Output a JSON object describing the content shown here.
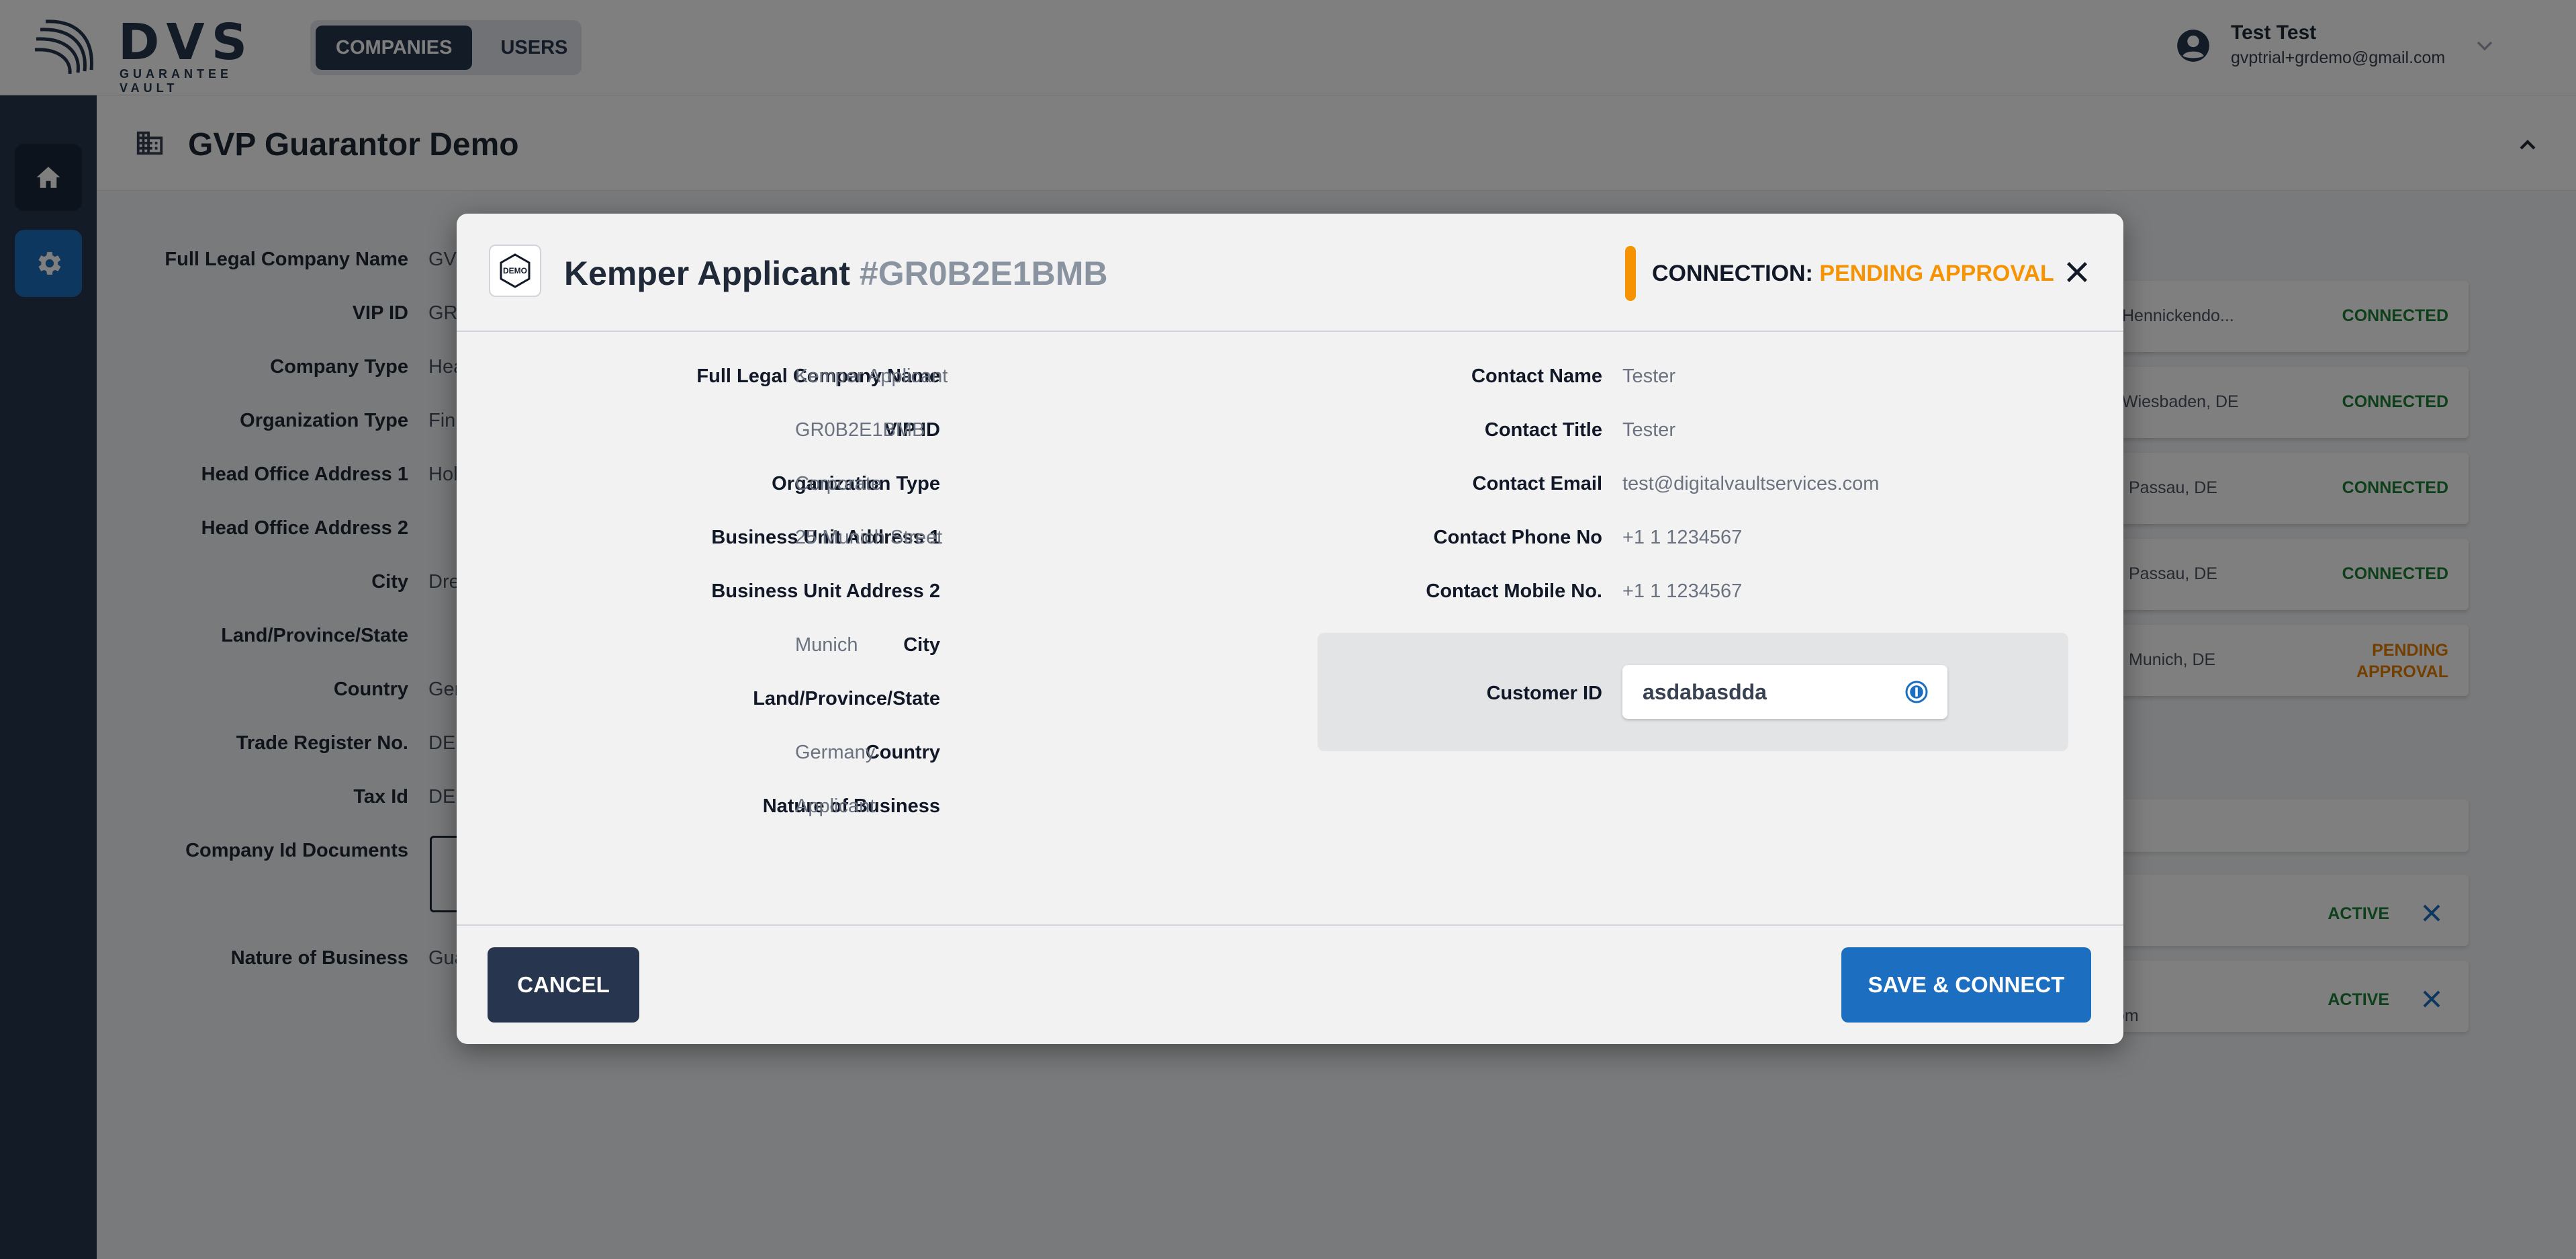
{
  "brand": {
    "name": "DVS",
    "tagline": "GUARANTEE VAULT"
  },
  "topnav": {
    "items": [
      {
        "label": "COMPANIES"
      },
      {
        "label": "USERS"
      }
    ]
  },
  "user": {
    "name": "Test Test",
    "email": "gvptrial+grdemo@gmail.com"
  },
  "sidebar": {
    "items": [
      {
        "icon": "home-icon"
      },
      {
        "icon": "gear-icon"
      }
    ]
  },
  "page": {
    "title": "GVP Guarantor Demo"
  },
  "background_fields": [
    {
      "label": "Full Legal Company Name",
      "value": "GV"
    },
    {
      "label": "VIP ID",
      "value": "GR"
    },
    {
      "label": "Company Type",
      "value": "Hea"
    },
    {
      "label": "Organization Type",
      "value": "Fin"
    },
    {
      "label": "Head Office Address 1",
      "value": "Hol"
    },
    {
      "label": "Head Office Address 2",
      "value": ""
    },
    {
      "label": "City",
      "value": "Dre"
    },
    {
      "label": "Land/Province/State",
      "value": ""
    },
    {
      "label": "Country",
      "value": "Ger"
    },
    {
      "label": "Trade Register No.",
      "value": "DE"
    },
    {
      "label": "Tax Id",
      "value": "DE"
    },
    {
      "label": "Company Id Documents",
      "value": ""
    },
    {
      "label": "Nature of Business",
      "value": "Gua"
    }
  ],
  "connections": [
    {
      "location": "Hennickendo...",
      "status": "CONNECTED"
    },
    {
      "location": "Wiesbaden, DE",
      "status": "CONNECTED"
    },
    {
      "location": "Passau, DE",
      "status": "CONNECTED"
    },
    {
      "location": "Passau, DE",
      "status": "CONNECTED"
    },
    {
      "location": "Munich, DE",
      "status": "PENDING\nAPPROVAL"
    }
  ],
  "user_rows": [
    {
      "status": "ACTIVE",
      "fragment": ""
    },
    {
      "status": "ACTIVE",
      "fragment": "om"
    }
  ],
  "modal": {
    "badge": "DEMO",
    "title": "Kemper Applicant",
    "vip": "#GR0B2E1BMB",
    "connection_label": "CONNECTION:",
    "connection_status": "PENDING APPROVAL",
    "left_fields": [
      {
        "label": "Full Legal Company Name",
        "value": "Kemper Applicant"
      },
      {
        "label": "VIP ID",
        "value": "GR0B2E1BMB"
      },
      {
        "label": "Organization Type",
        "value": "Corporate"
      },
      {
        "label": "Business Unit Address 1",
        "value": "25 Munich Street"
      },
      {
        "label": "Business Unit Address 2",
        "value": ""
      },
      {
        "label": "City",
        "value": "Munich"
      },
      {
        "label": "Land/Province/State",
        "value": ""
      },
      {
        "label": "Country",
        "value": "Germany"
      },
      {
        "label": "Nature of Business",
        "value": "Applicant"
      }
    ],
    "right_fields": [
      {
        "label": "Contact Name",
        "value": "Tester"
      },
      {
        "label": "Contact Title",
        "value": "Tester"
      },
      {
        "label": "Contact Email",
        "value": "test@digitalvaultservices.com"
      },
      {
        "label": "Contact Phone No",
        "value": "+1 1 1234567"
      },
      {
        "label": "Contact Mobile No.",
        "value": "+1 1 1234567"
      }
    ],
    "customer_id": {
      "label": "Customer ID",
      "value": "asdabasdda"
    },
    "cancel_label": "CANCEL",
    "save_label": "SAVE & CONNECT"
  }
}
